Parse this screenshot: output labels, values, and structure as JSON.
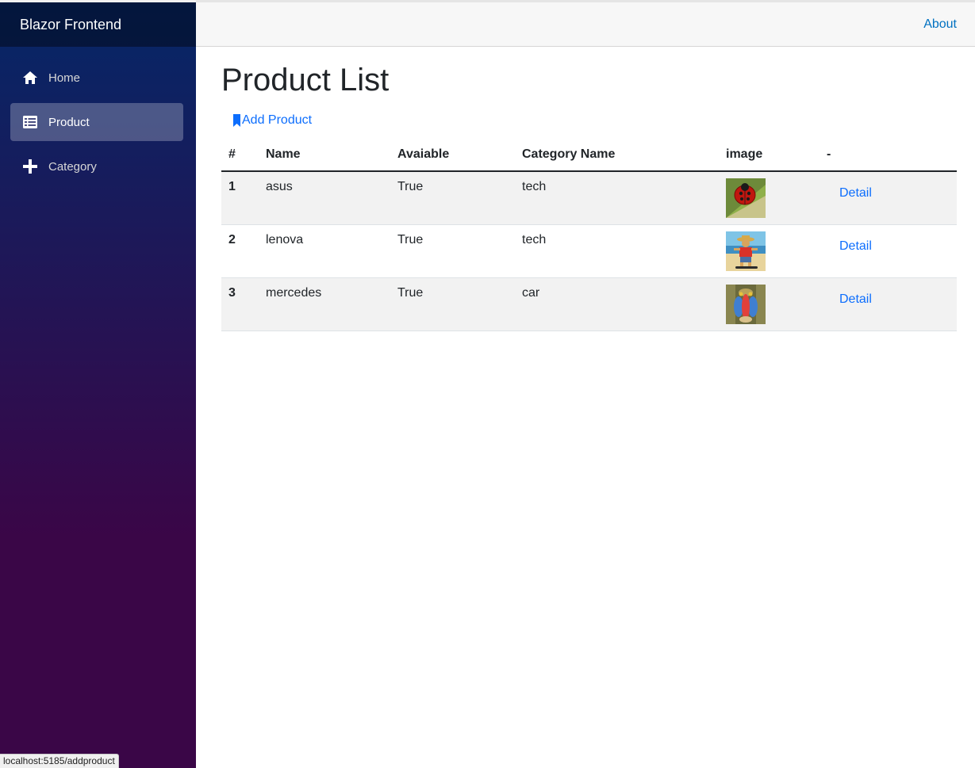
{
  "sidebar": {
    "brand": "Blazor Frontend",
    "items": [
      {
        "label": "Home",
        "icon": "home-icon",
        "active": false
      },
      {
        "label": "Product",
        "icon": "list-icon",
        "active": true
      },
      {
        "label": "Category",
        "icon": "plus-icon",
        "active": false
      }
    ]
  },
  "header": {
    "about_label": "About"
  },
  "main": {
    "title": "Product List",
    "add_label": "Add Product",
    "columns": [
      "#",
      "Name",
      "Avaiable",
      "Category Name",
      "image",
      "-"
    ],
    "rows": [
      {
        "id": "1",
        "name": "asus",
        "available": "True",
        "category": "tech",
        "image": "ladybug-image",
        "action": "Detail"
      },
      {
        "id": "2",
        "name": "lenova",
        "available": "True",
        "category": "tech",
        "image": "skateboard-cat-image",
        "action": "Detail"
      },
      {
        "id": "3",
        "name": "mercedes",
        "available": "True",
        "category": "car",
        "image": "mandrill-image",
        "action": "Detail"
      }
    ]
  },
  "status_bar": {
    "url": "localhost:5185/addproduct"
  },
  "colors": {
    "link": "#0d6efd",
    "about_link": "#0071c1",
    "sidebar_top": "#052767",
    "sidebar_bottom": "#3a0647",
    "active_item": "rgba(255,255,255,0.25)"
  }
}
